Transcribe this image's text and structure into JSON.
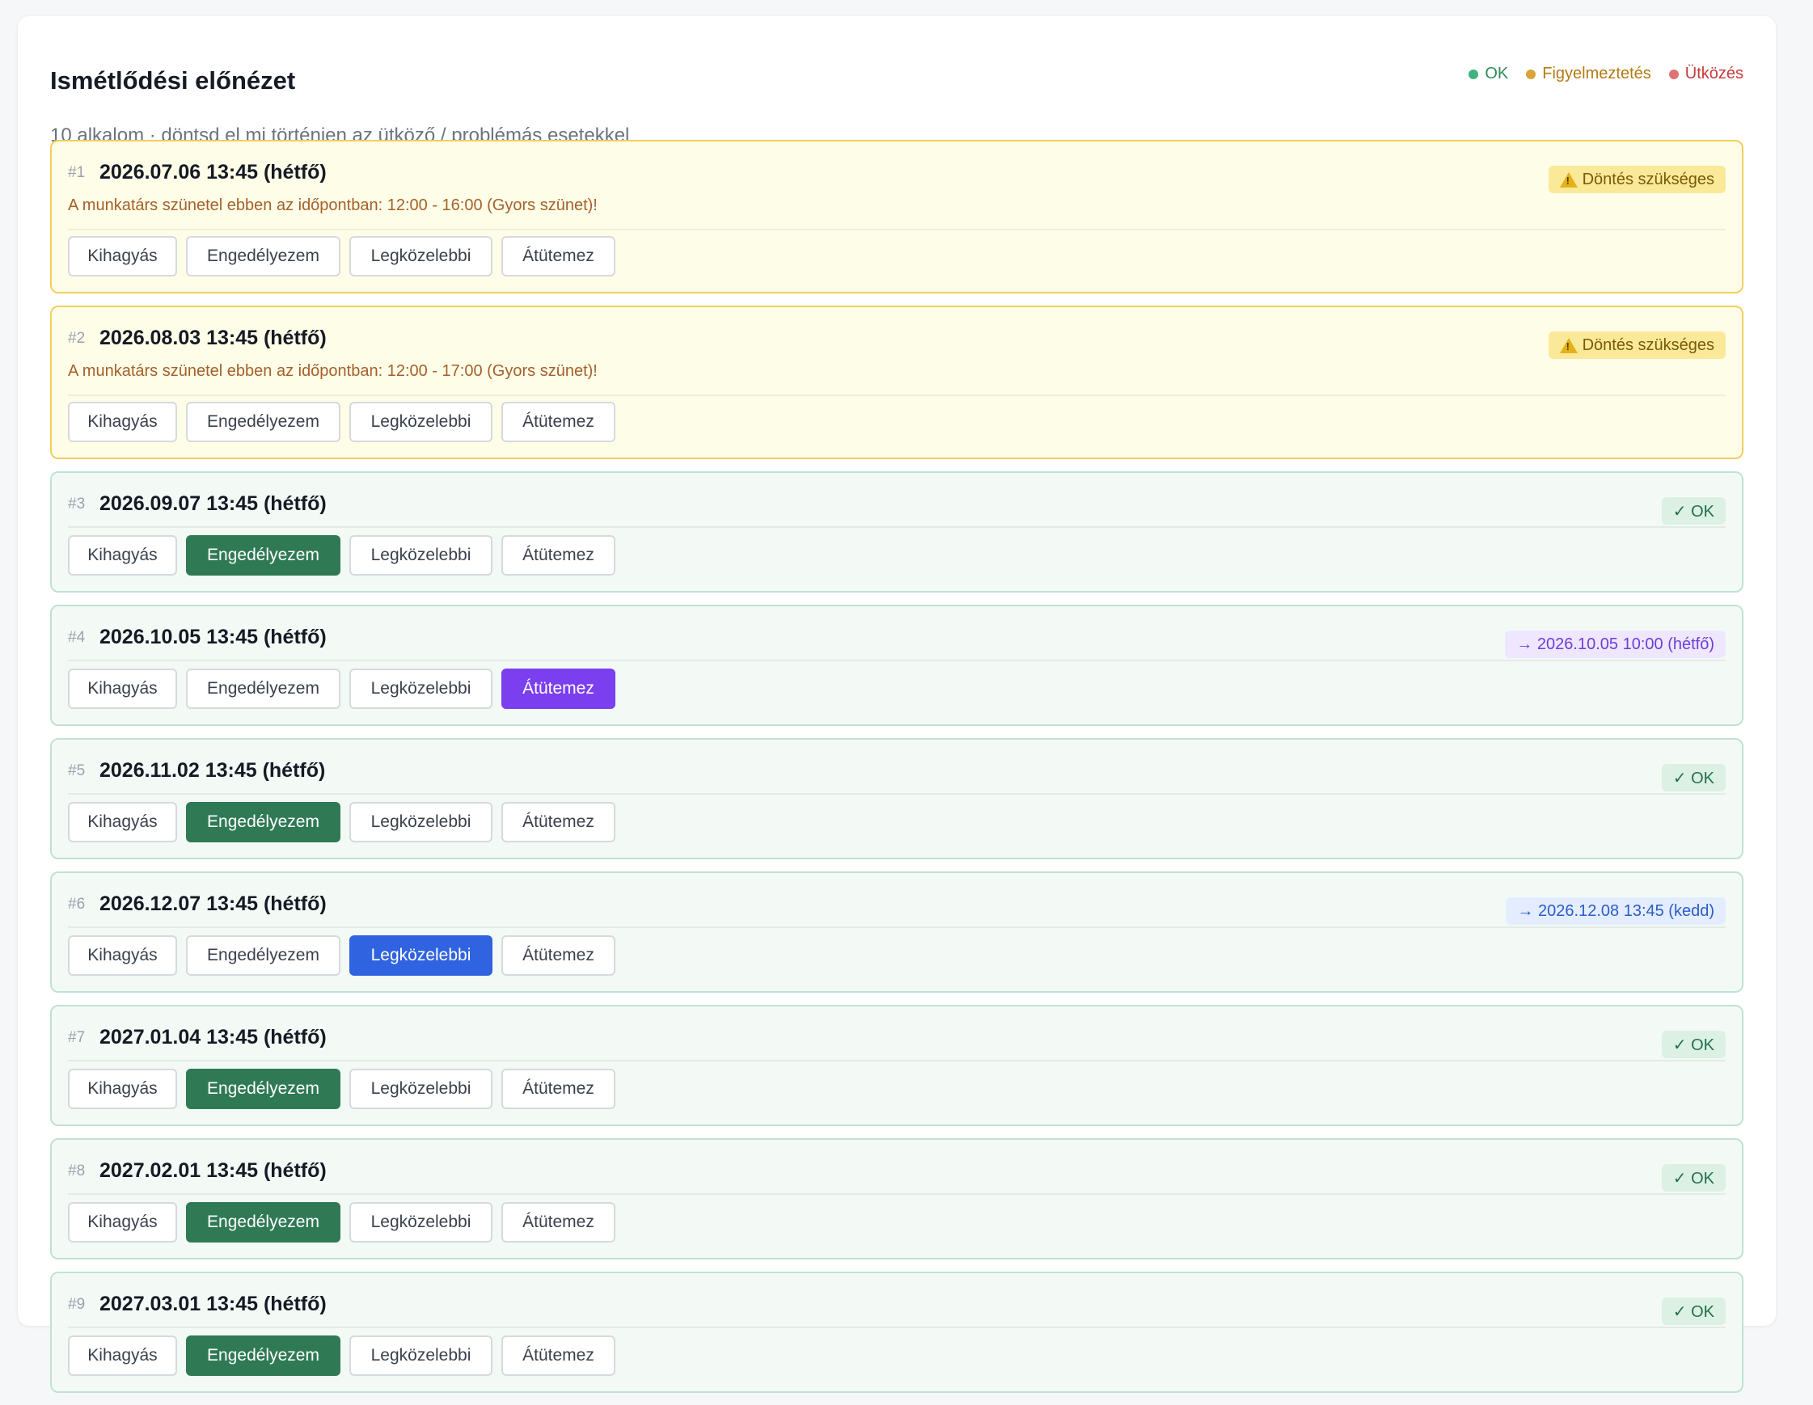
{
  "header": {
    "title": "Ismétlődési előnézet",
    "subtitle": "10 alkalom · döntsd el mi történjen az ütköző / problémás esetekkel"
  },
  "legend": [
    {
      "label": "OK",
      "color": "#3fb27f"
    },
    {
      "label": "Figyelmeztetés",
      "color": "#d9a53a"
    },
    {
      "label": "Ütközés",
      "color": "#e07272"
    }
  ],
  "buttons": {
    "skip": "Kihagyás",
    "allow": "Engedélyezem",
    "nearest": "Legközelebbi",
    "reschedule": "Átütemez"
  },
  "items": [
    {
      "idx": "#1",
      "date": "2026.07.06 13:45 (hétfő)",
      "status": "warn",
      "badge": "Döntés szükséges",
      "message": "A munkatárs szünetel ebben az időpontban: 12:00 - 16:00 (Gyors szünet)!",
      "selected": ""
    },
    {
      "idx": "#2",
      "date": "2026.08.03 13:45 (hétfő)",
      "status": "warn",
      "badge": "Döntés szükséges",
      "message": "A munkatárs szünetel ebben az időpontban: 12:00 - 17:00 (Gyors szünet)!",
      "selected": ""
    },
    {
      "idx": "#3",
      "date": "2026.09.07 13:45 (hétfő)",
      "status": "ok",
      "badge": "✓ OK",
      "selected": "allow"
    },
    {
      "idx": "#4",
      "date": "2026.10.05 13:45 (hétfő)",
      "status": "ok",
      "badge": "→ 2026.10.05 10:00 (hétfő)",
      "badge_style": "move-purple",
      "selected": "reschedule"
    },
    {
      "idx": "#5",
      "date": "2026.11.02 13:45 (hétfő)",
      "status": "ok",
      "badge": "✓ OK",
      "selected": "allow"
    },
    {
      "idx": "#6",
      "date": "2026.12.07 13:45 (hétfő)",
      "status": "ok",
      "badge": "→ 2026.12.08 13:45 (kedd)",
      "badge_style": "move-blue",
      "selected": "nearest"
    },
    {
      "idx": "#7",
      "date": "2027.01.04 13:45 (hétfő)",
      "status": "ok",
      "badge": "✓ OK",
      "selected": "allow"
    },
    {
      "idx": "#8",
      "date": "2027.02.01 13:45 (hétfő)",
      "status": "ok",
      "badge": "✓ OK",
      "selected": "allow"
    },
    {
      "idx": "#9",
      "date": "2027.03.01 13:45 (hétfő)",
      "status": "ok",
      "badge": "✓ OK",
      "selected": "allow"
    }
  ]
}
